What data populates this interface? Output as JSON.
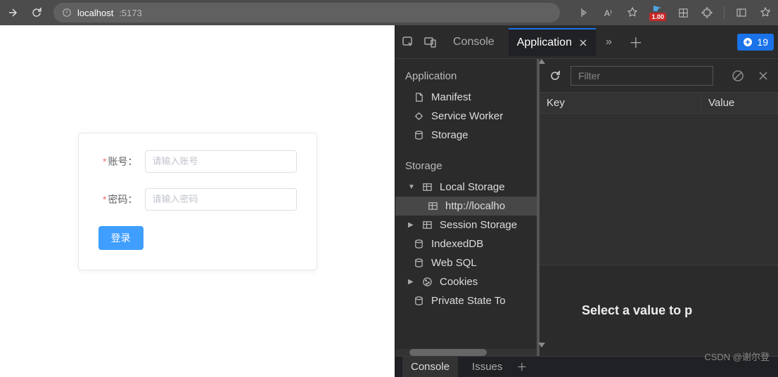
{
  "browser": {
    "url_host": "localhost",
    "url_port": ":5173",
    "badge": "1.00"
  },
  "login": {
    "account_label": "账号：",
    "account_placeholder": "请输入账号",
    "password_label": "密码：",
    "password_placeholder": "请输入密码",
    "submit": "登录"
  },
  "devtools": {
    "tabs": {
      "console": "Console",
      "application": "Application"
    },
    "issues_count": "19",
    "sidebar": {
      "section_app": "Application",
      "manifest": "Manifest",
      "service_workers": "Service Worker",
      "storage": "Storage",
      "section_storage": "Storage",
      "local_storage": "Local Storage",
      "ls_origin": "http://localho",
      "session_storage": "Session Storage",
      "indexeddb": "IndexedDB",
      "websql": "Web SQL",
      "cookies": "Cookies",
      "private_state": "Private State To"
    },
    "content": {
      "filter_placeholder": "Filter",
      "col_key": "Key",
      "col_value": "Value",
      "preview_text": "Select a value to p"
    },
    "drawer": {
      "console": "Console",
      "issues": "Issues"
    }
  },
  "watermark": "CSDN @谢尔登"
}
